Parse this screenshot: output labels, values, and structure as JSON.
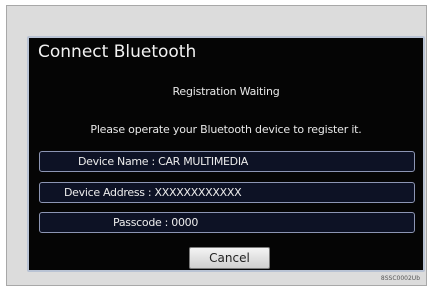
{
  "dialog": {
    "title": "Connect Bluetooth",
    "status": "Registration Waiting",
    "instruction": "Please operate your Bluetooth device to register it.",
    "device_name": "Device Name : CAR MULTIMEDIA",
    "device_address": "Device Address : XXXXXXXXXXXX",
    "passcode": "Passcode : 0000",
    "cancel_label": "Cancel"
  },
  "footer": {
    "code": "8SSC0002Ub"
  }
}
